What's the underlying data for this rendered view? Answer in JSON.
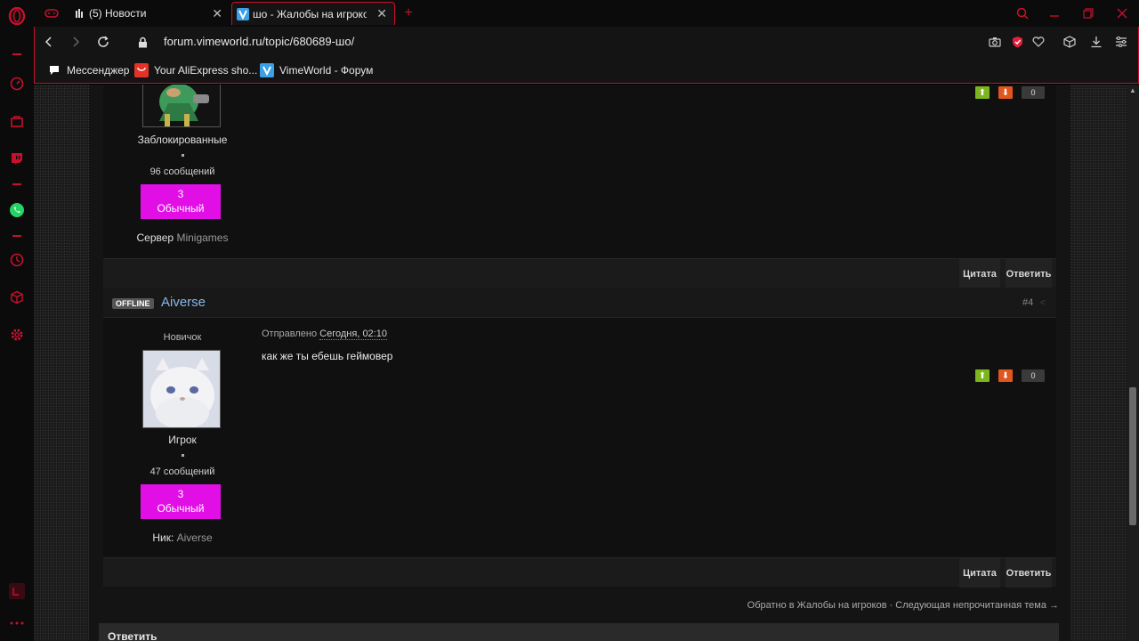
{
  "browser": {
    "tabs": [
      {
        "label": "(5) Новости"
      },
      {
        "label": "шо - Жалобы на игроков"
      }
    ],
    "url": "forum.vimeworld.ru/topic/680689-шо/",
    "bookmarks": [
      {
        "label": "Мессенджер"
      },
      {
        "label": "Your AliExpress sho..."
      },
      {
        "label": "VimeWorld - Форум"
      }
    ],
    "colors": {
      "accent": "#c8102e"
    }
  },
  "posts": [
    {
      "group": "Заблокированные",
      "posts_count": "96 сообщений",
      "rank_level": "3",
      "rank_name": "Обычный",
      "field_label": "Сервер",
      "field_value": "Minigames",
      "rep": "0",
      "quote": "Цитата",
      "reply": "Ответить"
    },
    {
      "status": "OFFLINE",
      "author": "Aiverse",
      "number": "#4",
      "title": "Новичок",
      "date_prefix": "Отправлено",
      "date_value": "Сегодня, 02:10",
      "text": "как же ты ебешь геймовер",
      "group": "Игрок",
      "posts_count": "47 сообщений",
      "rank_level": "3",
      "rank_name": "Обычный",
      "field_label": "Ник:",
      "field_value": "Aiverse",
      "rep": "0",
      "quote": "Цитата",
      "reply": "Ответить"
    }
  ],
  "bottom_nav": "Обратно в Жалобы на игроков · Следующая непрочитанная тема →",
  "reply_button": "Ответить",
  "colors": {
    "rank_badge": "#e10ee6",
    "rep_up": "#7db51d",
    "rep_down": "#e0561e",
    "author_link": "#88b7e8"
  }
}
